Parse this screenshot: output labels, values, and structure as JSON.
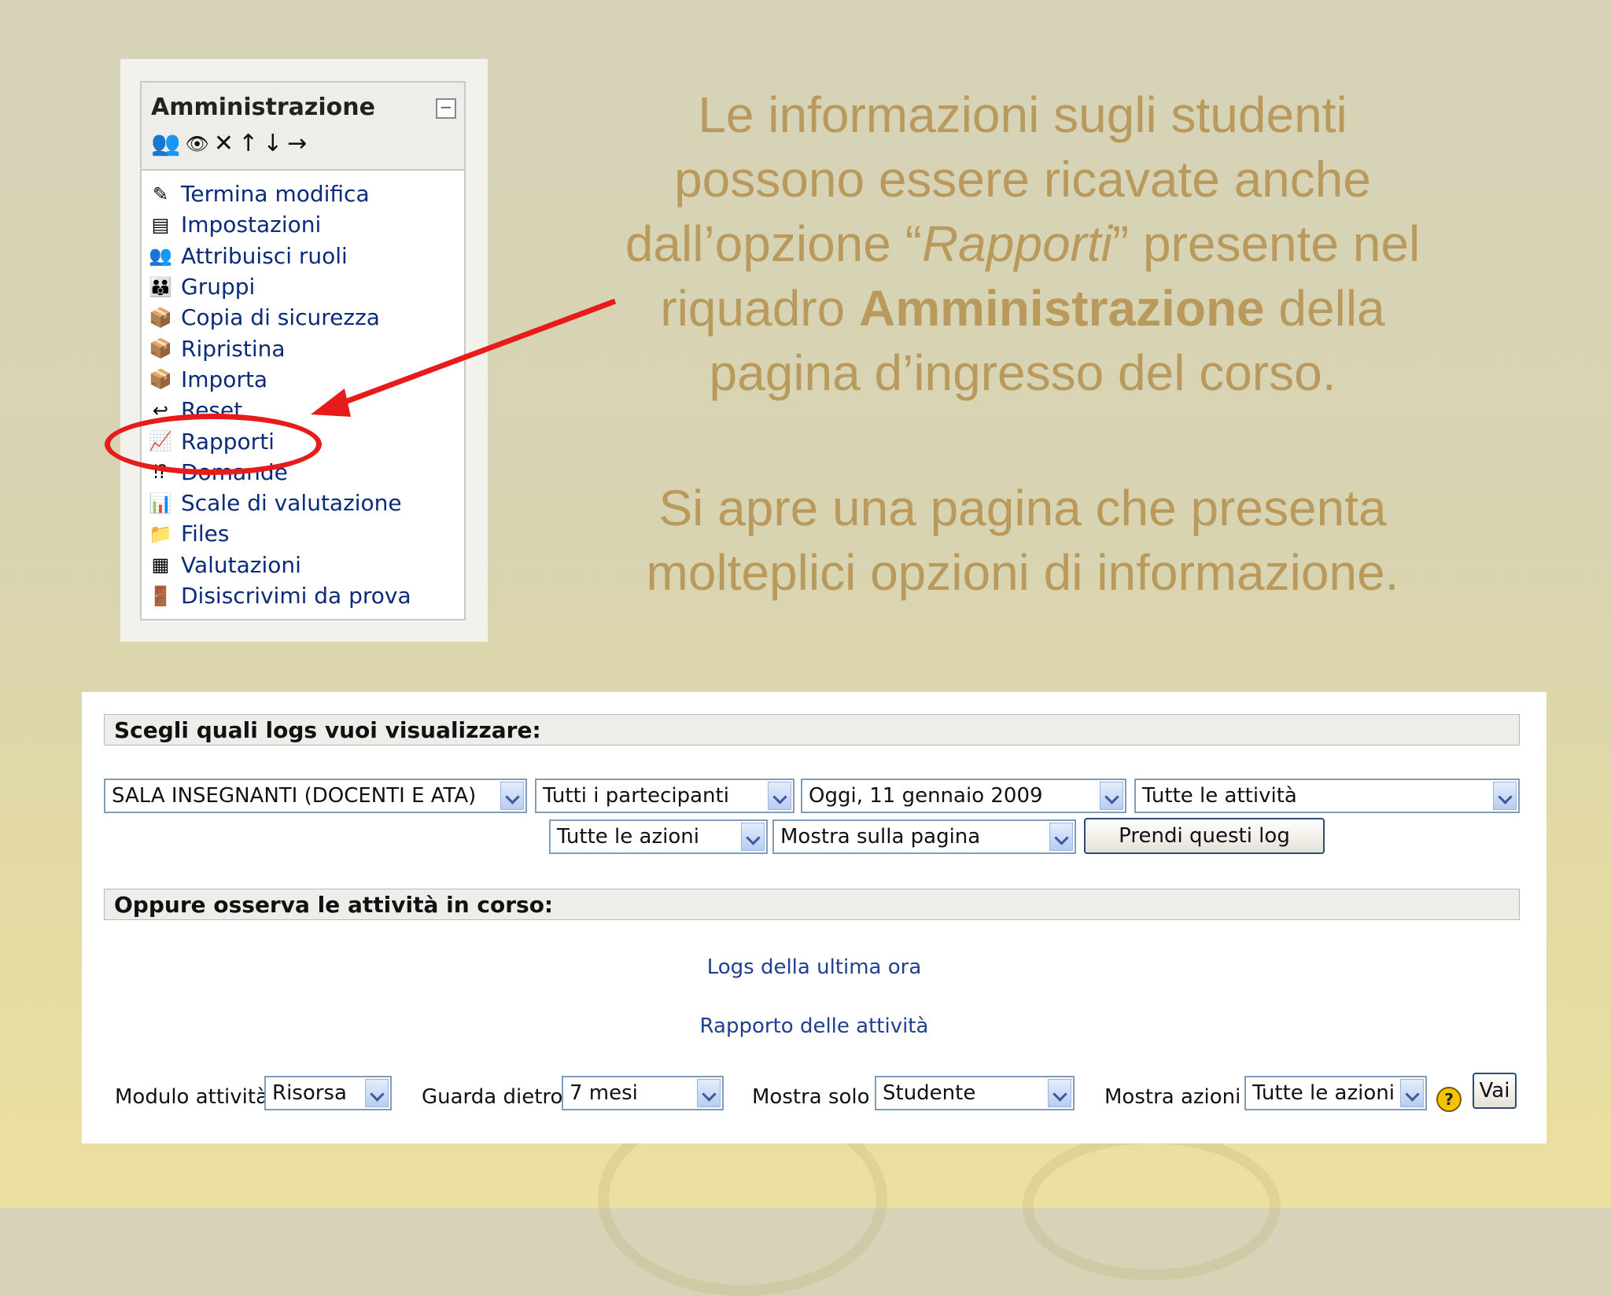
{
  "admin_block": {
    "title": "Amministrazione",
    "collapse_symbol": "−",
    "items": [
      {
        "label": "Termina modifica",
        "icon": "✎"
      },
      {
        "label": "Impostazioni",
        "icon": "▤"
      },
      {
        "label": "Attribuisci ruoli",
        "icon": "👥"
      },
      {
        "label": "Gruppi",
        "icon": "👪"
      },
      {
        "label": "Copia di sicurezza",
        "icon": "📦"
      },
      {
        "label": "Ripristina",
        "icon": "📦"
      },
      {
        "label": "Importa",
        "icon": "📦"
      },
      {
        "label": "Reset",
        "icon": "↩"
      },
      {
        "label": "Rapporti",
        "icon": "📈"
      },
      {
        "label": "Domande",
        "icon": "⁉"
      },
      {
        "label": "Scale di valutazione",
        "icon": "📊"
      },
      {
        "label": "Files",
        "icon": "📁"
      },
      {
        "label": "Valutazioni",
        "icon": "▦"
      },
      {
        "label": "Disiscrivimi da prova",
        "icon": "🚪"
      }
    ]
  },
  "explanation": {
    "para1": {
      "line1": "Le informazioni sugli studenti",
      "line2": "possono essere ricavate anche",
      "line3_pre": "dall’opzione “",
      "line3_em": "Rapporti",
      "line3_post": "” presente nel",
      "line4_pre": "riquadro ",
      "line4_bold": "Amministrazione",
      "line4_post": " della",
      "line5": "pagina d’ingresso del corso."
    },
    "para2": {
      "line1": "Si apre una pagina che presenta",
      "line2": "molteplici opzioni di informazione."
    }
  },
  "logs": {
    "header1": "Scegli quali logs vuoi visualizzare:",
    "course_select": "SALA INSEGNANTI (DOCENTI E ATA)",
    "participants_select": "Tutti i partecipanti",
    "date_select": "Oggi, 11 gennaio 2009",
    "activities_select": "Tutte le attività",
    "actions_select": "Tutte le azioni",
    "display_select": "Mostra sulla pagina",
    "get_logs_button": "Prendi questi log",
    "header2": "Oppure osserva le attività in corso:",
    "link_last_hour": "Logs della ultima ora",
    "link_activity_report": "Rapporto delle attività",
    "module_label": "Modulo attività",
    "module_value": "Risorsa",
    "look_back_label": "Guarda dietro",
    "look_back_value": "7 mesi",
    "show_only_label": "Mostra solo",
    "show_only_value": "Studente",
    "show_actions_label": "Mostra azioni",
    "show_actions_value": "Tutte le azioni",
    "help_symbol": "?",
    "go_button": "Vai"
  },
  "colors": {
    "explanation_text": "#b99a5c",
    "highlight": "#e81b1b",
    "link": "#1f3f8f"
  }
}
